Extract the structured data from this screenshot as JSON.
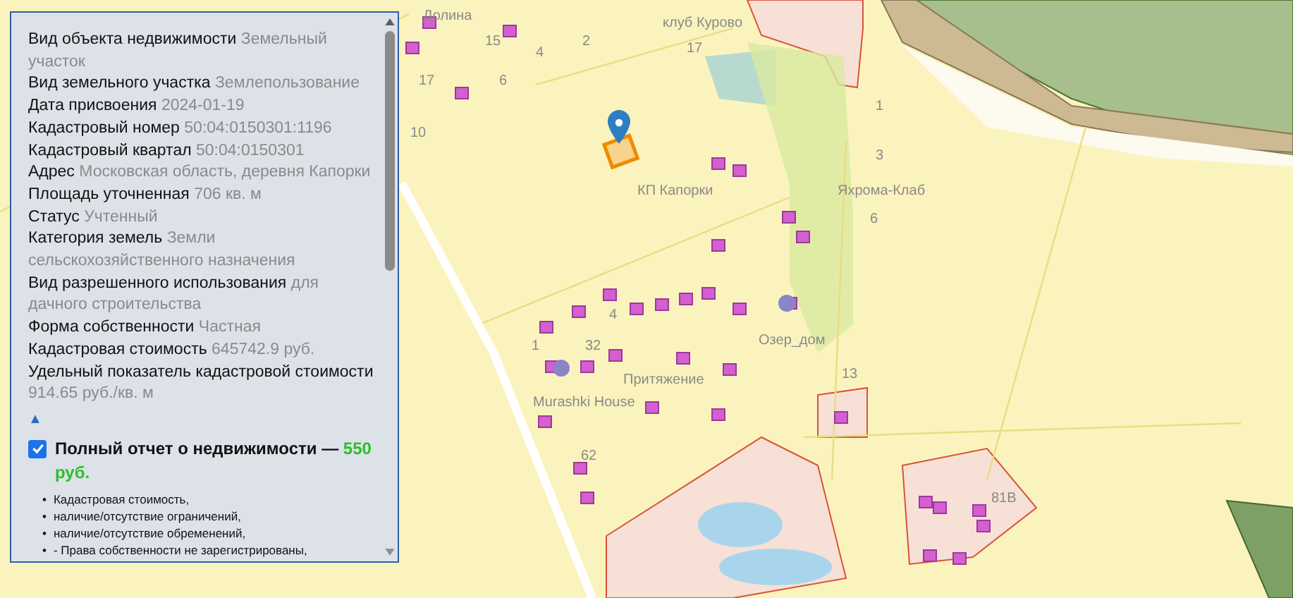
{
  "map": {
    "labels": [
      {
        "text": "Долина"
      },
      {
        "text": "клуб Курово"
      },
      {
        "text": "15"
      },
      {
        "text": "2"
      },
      {
        "text": "17"
      },
      {
        "text": "4"
      },
      {
        "text": "17"
      },
      {
        "text": "6"
      },
      {
        "text": "1"
      },
      {
        "text": "10"
      },
      {
        "text": "3"
      },
      {
        "text": "КП Капорки"
      },
      {
        "text": "Яхрома-Клаб"
      },
      {
        "text": "6"
      },
      {
        "text": "4"
      },
      {
        "text": "1"
      },
      {
        "text": "32"
      },
      {
        "text": "Озер_дом"
      },
      {
        "text": "13"
      },
      {
        "text": "Притяжение"
      },
      {
        "text": "Murashki House"
      },
      {
        "text": "62"
      },
      {
        "text": "81В"
      }
    ]
  },
  "panel": {
    "fields": [
      {
        "label": "Вид объекта недвижимости",
        "value": "Земельный участок"
      },
      {
        "label": "Вид земельного участка",
        "value": "Землепользование"
      },
      {
        "label": "Дата присвоения",
        "value": "2024-01-19"
      },
      {
        "label": "Кадастровый номер",
        "value": "50:04:0150301:1196"
      },
      {
        "label": "Кадастровый квартал",
        "value": "50:04:0150301"
      },
      {
        "label": "Адрес",
        "value": "Московская область, деревня Капорки"
      },
      {
        "label": "Площадь уточненная",
        "value": "706 кв. м"
      },
      {
        "label": "Статус",
        "value": "Учтенный"
      },
      {
        "label": "Категория земель",
        "value": "Земли сельскохозяйственного назначения"
      },
      {
        "label": "Вид разрешенного использования",
        "value": "для дачного строительства"
      },
      {
        "label": "Форма собственности",
        "value": "Частная"
      },
      {
        "label": "Кадастровая стоимость",
        "value": "645742.9 руб."
      },
      {
        "label": "Удельный показатель кадастровой стоимости",
        "value": "914.65 руб./кв. м"
      }
    ],
    "collapse": "▲",
    "report": {
      "checked": true,
      "bullet": "•",
      "title": "Полный отчет о недвижимости —",
      "price": "550 руб.",
      "items": [
        "Кадастровая стоимость,",
        "наличие/отсутствие ограничений,",
        "наличие/отсутствие обременений,",
        "- Права собственности не зарегистрированы,"
      ]
    }
  }
}
